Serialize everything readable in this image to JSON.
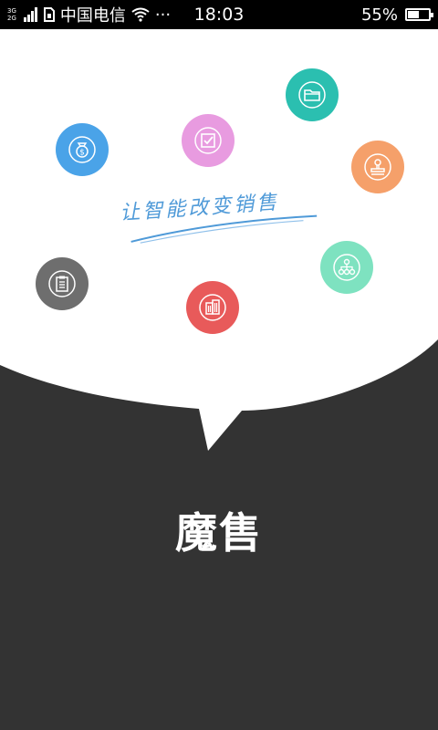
{
  "status_bar": {
    "network_top": "3G",
    "network_bottom": "2G",
    "carrier": "中国电信",
    "more": "···",
    "time": "18:03",
    "battery_percent_text": "55%",
    "battery_level": 0.55
  },
  "splash": {
    "slogan": "让智能改变销售",
    "brand": "魔售"
  },
  "colors": {
    "background_dark": "#333333",
    "bubble": "#ffffff",
    "folder": "#2bbfb0",
    "checklist": "#e89be0",
    "money": "#4aa3e8",
    "stamp": "#f5a06a",
    "clipboard": "#6e6e6e",
    "org_chart": "#7ee2c0",
    "building": "#e85a5a",
    "slogan": "#4f9ad8"
  },
  "icons": [
    "folder-icon",
    "checklist-icon",
    "money-bag-icon",
    "stamp-icon",
    "clipboard-icon",
    "org-chart-icon",
    "building-icon"
  ]
}
